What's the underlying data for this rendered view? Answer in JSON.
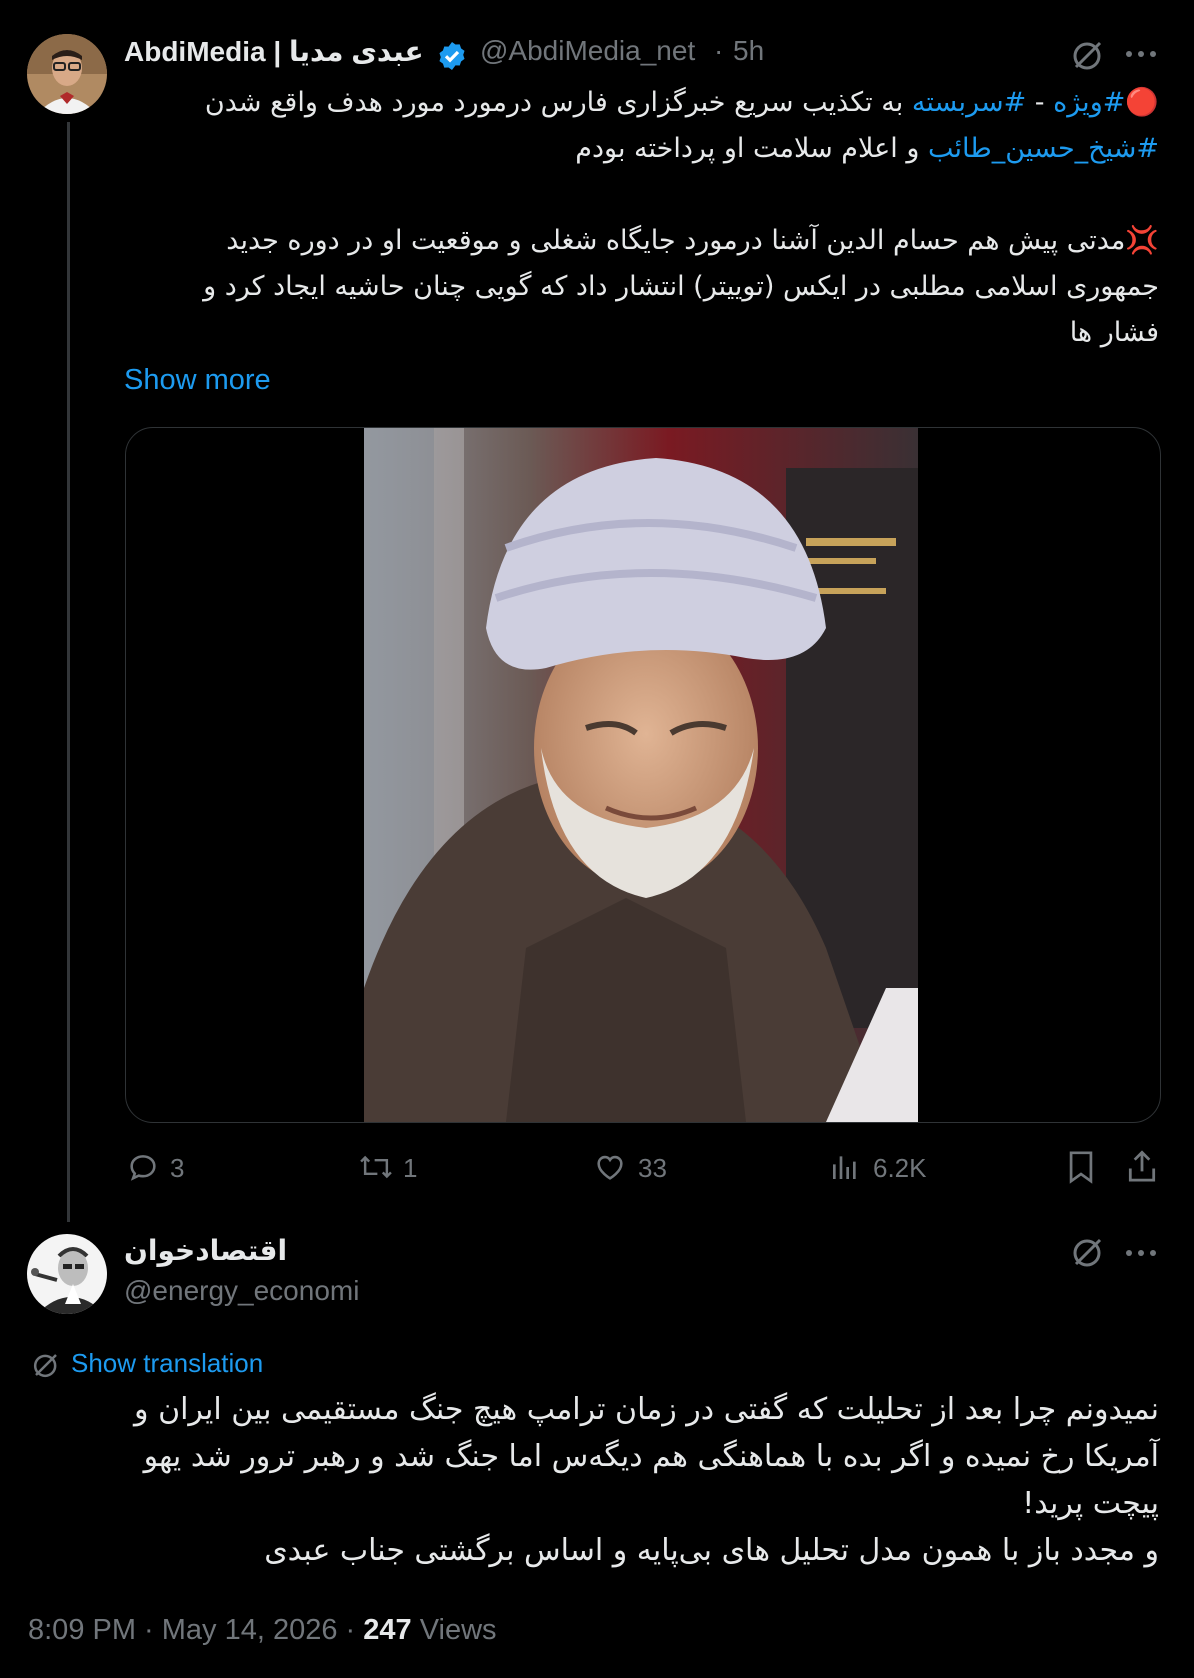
{
  "tweet": {
    "display_name": "AbdiMedia | عبدی مدیا",
    "handle": "@AbdiMedia_net",
    "separator": "·",
    "time": "5h",
    "line1_emoji": "🔴",
    "line1_tag1": "#ویژه",
    "line1_dash": " - ",
    "line1_tag2": "#سربسته",
    "line1_text": " به تکذیب سریع خبرگزاری فارس درمورد مورد هدف واقع شدن",
    "line2_tag": "#شیخ_حسین_طائب",
    "line2_text": " و اعلام سلامت او پرداخته بودم",
    "para2_emoji": "💢",
    "para2_line1": "مدتی پیش هم حسام الدین آشنا درمورد جایگاه شغلی و موقعیت او در دوره جدید",
    "para2_line2": "جمهوری اسلامی مطلبی در ایکس (توییتر) انتشار داد که گویی چنان حاشیه ایجاد کرد و",
    "para2_line3": "فشار ها",
    "show_more": "Show more",
    "actions": {
      "replies": "3",
      "reposts": "1",
      "likes": "33",
      "views": "6.2K"
    }
  },
  "reply": {
    "display_name": "اقتصادخوان",
    "handle": "@energy_economi",
    "show_translation": "Show translation",
    "line1": "نمیدونم چرا بعد از تحلیلت که گفتی در زمان ترامپ هیچ جنگ مستقیمی بین ایران و",
    "line2": "آمریکا رخ نمیده و اگر بده با هماهنگی هم دیگه‌س اما جنگ شد و رهبر ترور شد یهو",
    "line3": "پیچت پرید!",
    "line4": "و مجدد باز با همون مدل تحلیل های بی‌پایه و اساس برگشتی جناب عبدی",
    "timestamp": "8:09 PM · May 14, 2026 · ",
    "views_count": "247",
    "views_label": " Views"
  },
  "colors": {
    "accent": "#1d9bf0",
    "muted": "#71767b",
    "text": "#e7e9ea",
    "background": "#000000"
  },
  "icons": [
    "grok-icon",
    "more-icon",
    "verified-badge-icon",
    "reply-icon",
    "repost-icon",
    "like-icon",
    "views-icon",
    "bookmark-icon",
    "share-icon",
    "translate-icon"
  ]
}
